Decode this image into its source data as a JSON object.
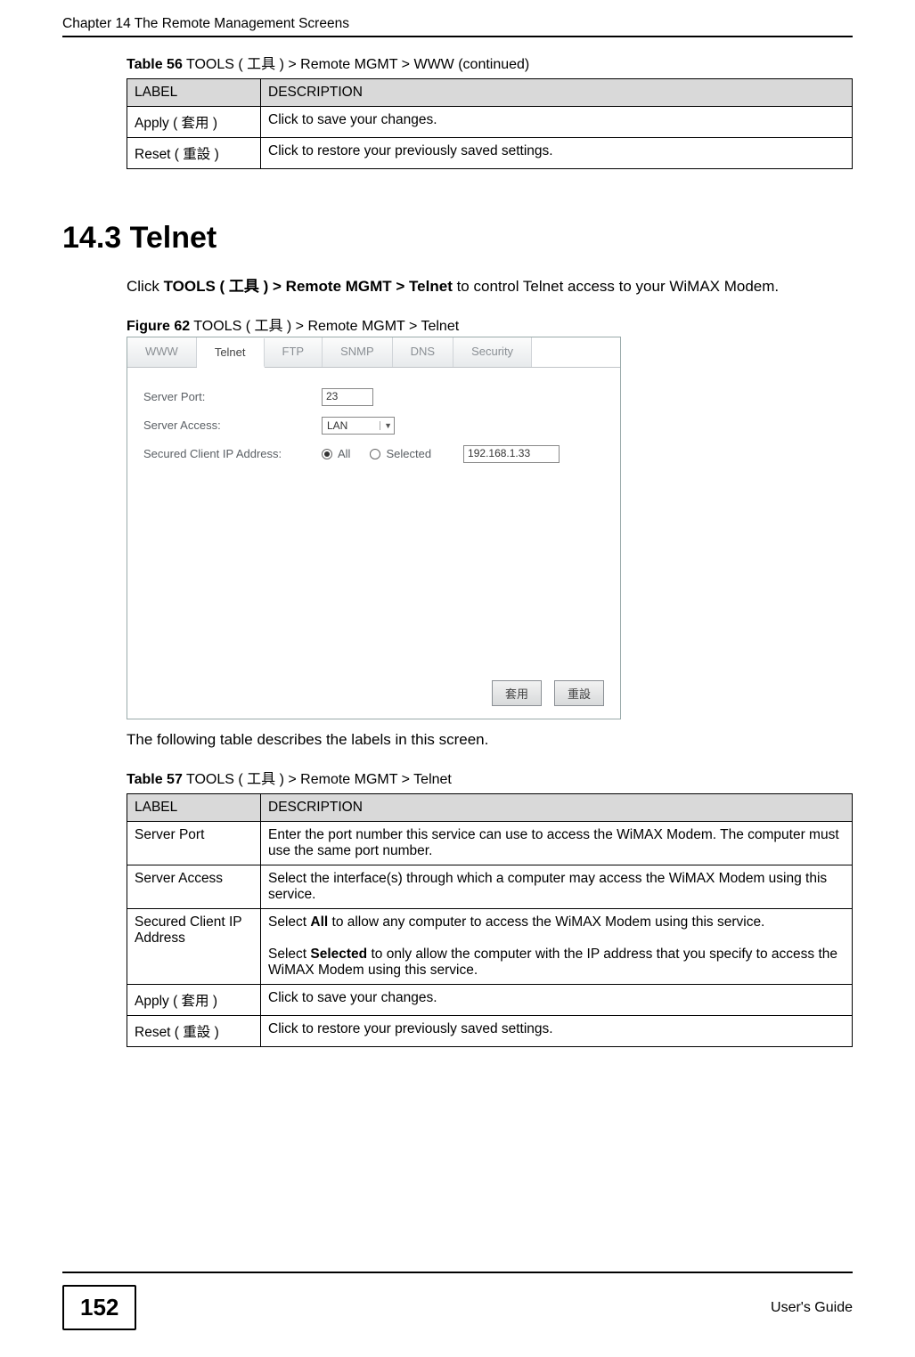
{
  "header": {
    "running": "Chapter 14 The Remote Management Screens"
  },
  "table56": {
    "caption_strong": "Table 56",
    "caption_rest": "   TOOLS ( 工具 )  > Remote MGMT > WWW (continued)",
    "col_label": "LABEL",
    "col_desc": "DESCRIPTION",
    "rows": [
      {
        "label": "Apply ( 套用 )",
        "desc": "Click to save your changes."
      },
      {
        "label": "Reset ( 重設 )",
        "desc": "Click to restore your previously saved settings."
      }
    ]
  },
  "section": {
    "heading": "14.3  Telnet",
    "intro_pre": "Click ",
    "intro_bold": "TOOLS ( 工具 ) > Remote MGMT > Telnet",
    "intro_post": " to control Telnet access to your WiMAX Modem."
  },
  "figure": {
    "caption_strong": "Figure 62",
    "caption_rest": "   TOOLS ( 工具 )  > Remote MGMT > Telnet",
    "tabs": [
      "WWW",
      "Telnet",
      "FTP",
      "SNMP",
      "DNS",
      "Security"
    ],
    "active_tab_index": 1,
    "rows": {
      "server_port_label": "Server Port:",
      "server_port_value": "23",
      "server_access_label": "Server Access:",
      "server_access_value": "LAN",
      "secured_label": "Secured Client IP Address:",
      "radio_all": "All",
      "radio_selected": "Selected",
      "ip_value": "192.168.1.33"
    },
    "buttons": {
      "apply": "套用",
      "reset": "重設"
    }
  },
  "between_text": "The following table describes the labels in this screen.",
  "table57": {
    "caption_strong": "Table 57",
    "caption_rest": "   TOOLS ( 工具 )  > Remote MGMT > Telnet",
    "col_label": "LABEL",
    "col_desc": "DESCRIPTION",
    "rows": [
      {
        "label": "Server Port",
        "desc": "Enter the port number this service can use to access the WiMAX Modem. The computer must use the same port number."
      },
      {
        "label": "Server Access",
        "desc": "Select the interface(s) through which a computer may access the WiMAX Modem using this service."
      },
      {
        "label": "Secured Client IP Address",
        "desc_p1_pre": "Select ",
        "desc_p1_b": "All",
        "desc_p1_post": " to allow any computer to access the WiMAX Modem using this service.",
        "desc_p2_pre": "Select ",
        "desc_p2_b": "Selected",
        "desc_p2_post": " to only allow the computer with the IP address that you specify to access the WiMAX Modem using this service."
      },
      {
        "label": "Apply ( 套用 )",
        "desc": "Click to save your changes."
      },
      {
        "label": "Reset ( 重設 )",
        "desc": "Click to restore your previously saved settings."
      }
    ]
  },
  "footer": {
    "page": "152",
    "guide": "User's Guide"
  }
}
